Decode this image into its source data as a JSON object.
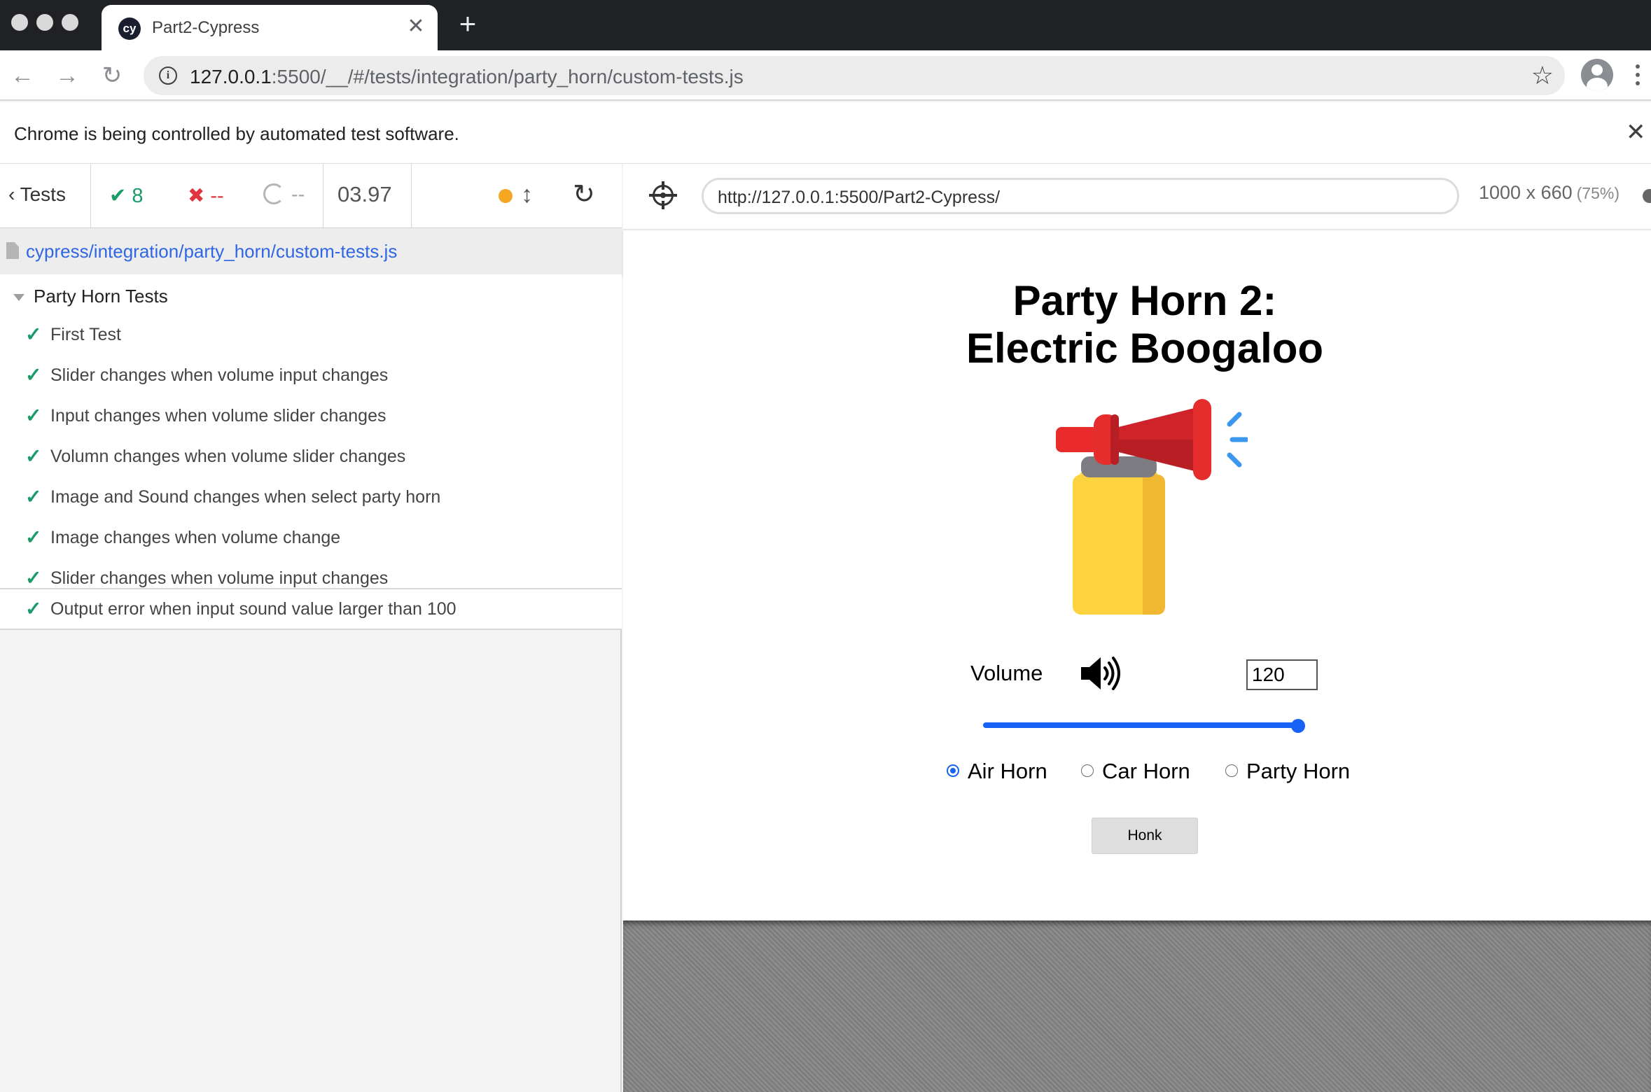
{
  "browser": {
    "tab_title": "Part2-Cypress",
    "tab_logo": "cy",
    "tab_close": "✕",
    "new_tab": "+",
    "url_host": "127.0.0.1",
    "url_rest": ":5500/__/#/tests/integration/party_horn/custom-tests.js",
    "infobar_text": "Chrome is being controlled by automated test software.",
    "infobar_close": "✕",
    "icons": [
      "back-arrow-icon",
      "forward-arrow-icon",
      "reload-icon",
      "info-icon",
      "star-icon",
      "profile-icon",
      "menu-dots-icon"
    ]
  },
  "reporter": {
    "back_label": "Tests",
    "passed": "8",
    "failed": "--",
    "pending": "--",
    "duration": "03.97",
    "spec_path": "cypress/integration/party_horn/custom-tests.js",
    "suite_title": "Party Horn Tests",
    "tests": [
      {
        "title": "First Test",
        "state": "passed"
      },
      {
        "title": "Slider changes when volume input changes",
        "state": "passed"
      },
      {
        "title": "Input changes when volume slider changes",
        "state": "passed"
      },
      {
        "title": "Volumn changes when volume slider changes",
        "state": "passed"
      },
      {
        "title": "Image and Sound changes when select party horn",
        "state": "passed"
      },
      {
        "title": "Image changes when volume change",
        "state": "passed"
      },
      {
        "title": "Slider changes when volume input changes",
        "state": "passed"
      },
      {
        "title": "Output error when input sound value larger than 100",
        "state": "passed"
      }
    ],
    "colors": {
      "pass": "#1a9c6a",
      "fail": "#e0343e",
      "running_dot": "#f5a623",
      "link": "#2f66e6"
    }
  },
  "aut": {
    "url": "http://127.0.0.1:5500/Part2-Cypress/",
    "viewport": "1000 x 660",
    "scale": "(75%)"
  },
  "app": {
    "title_line1": "Party Horn 2:",
    "title_line2": "Electric Boogaloo",
    "image": "air-horn-image",
    "volume_label": "Volume",
    "volume_icon": "speaker-volume-icon",
    "volume_value": "120",
    "slider_value": 100,
    "radio_options": [
      {
        "label": "Air Horn",
        "checked": true
      },
      {
        "label": "Car Horn",
        "checked": false
      },
      {
        "label": "Party Horn",
        "checked": false
      }
    ],
    "honk_label": "Honk",
    "accent_color": "#1862f6"
  }
}
